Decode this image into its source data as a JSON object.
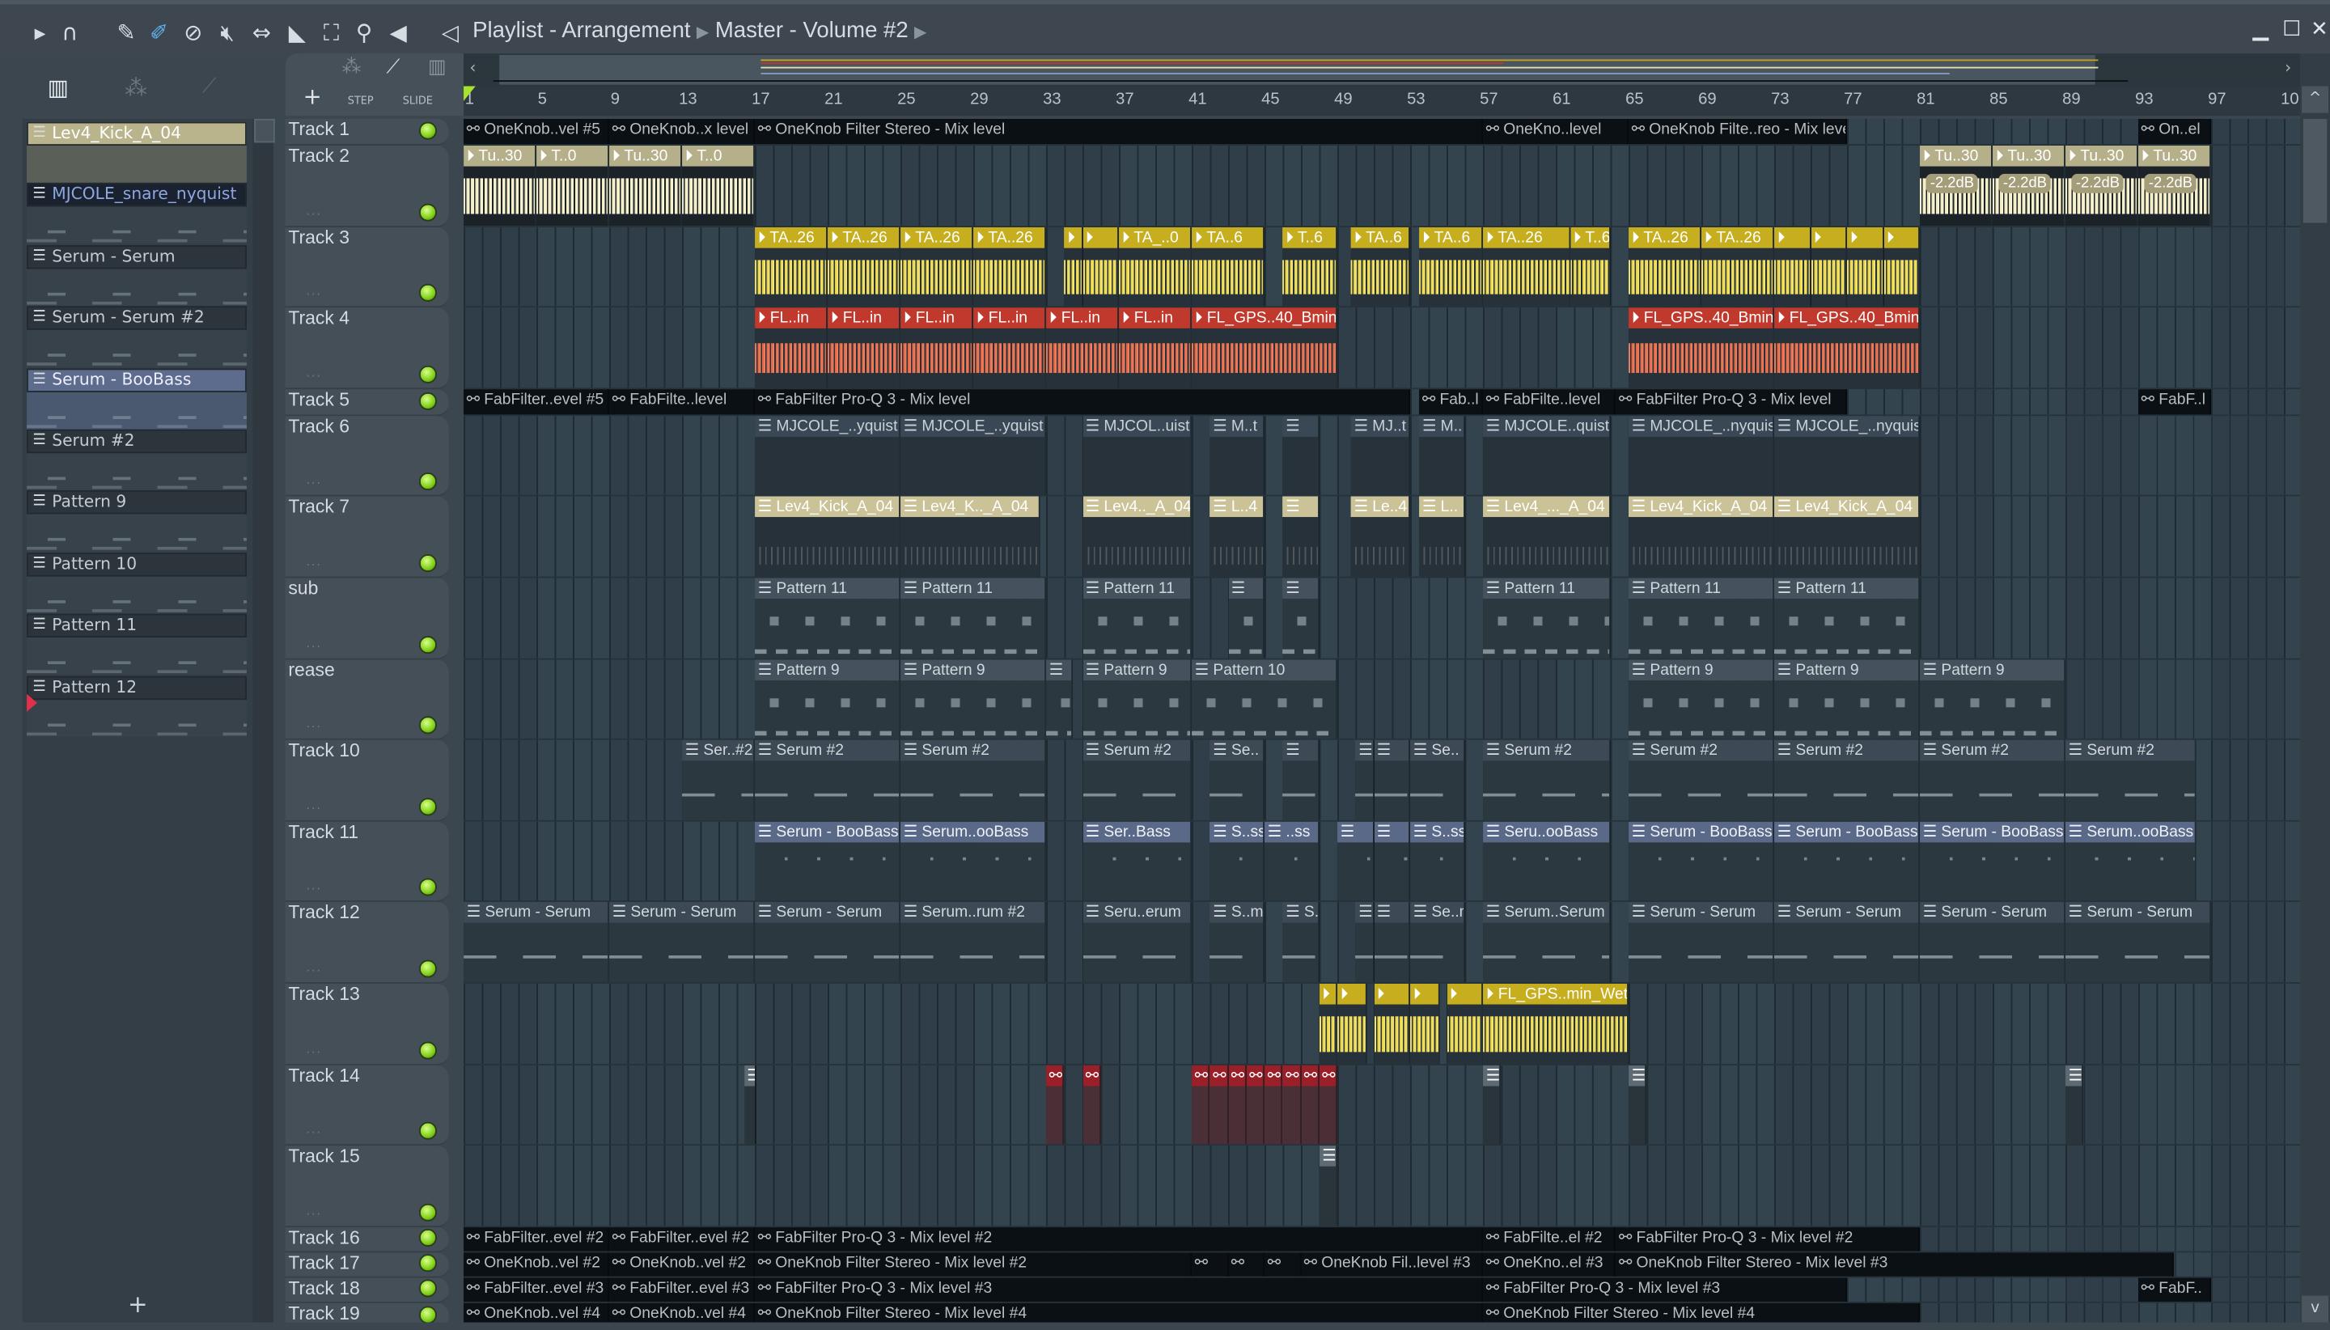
{
  "window": {
    "title": "Playlist - Arrangement",
    "breadcrumb": [
      "Playlist - Arrangement",
      "Master - Volume #2"
    ]
  },
  "toolbar": {
    "icons": [
      "play-arrow-icon",
      "magnet-icon",
      "pencil-icon",
      "paint-brush-icon",
      "delete-icon",
      "mute-icon",
      "slip-icon",
      "slice-icon",
      "select-icon",
      "zoom-icon",
      "playback-icon",
      "speaker-icon"
    ],
    "step_label": "STEP",
    "slide_label": "SLIDE",
    "add_label": "+"
  },
  "ruler": {
    "ticks": [
      "1",
      "5",
      "9",
      "13",
      "17",
      "21",
      "25",
      "29",
      "33",
      "37",
      "41",
      "45",
      "49",
      "53",
      "57",
      "61",
      "65",
      "69",
      "73",
      "77",
      "81",
      "85",
      "89",
      "93",
      "97",
      "10"
    ]
  },
  "patterns": [
    {
      "name": "Lev4_Kick_A_04",
      "style": "sel"
    },
    {
      "name": "MJCOLE_snare_nyquist",
      "style": "blue"
    },
    {
      "name": "Serum - Serum",
      "style": ""
    },
    {
      "name": "Serum - Serum #2",
      "style": ""
    },
    {
      "name": "Serum - BooBass",
      "style": "boo"
    },
    {
      "name": "Serum #2",
      "style": ""
    },
    {
      "name": "Pattern 9",
      "style": ""
    },
    {
      "name": "Pattern 10",
      "style": ""
    },
    {
      "name": "Pattern 11",
      "style": ""
    },
    {
      "name": "Pattern 12",
      "style": ""
    }
  ],
  "tracks": [
    {
      "name": "Track 1",
      "kind": "auto",
      "clips": [
        [
          1,
          9,
          "OneKnob..vel #5"
        ],
        [
          9,
          17,
          "OneKnob..x level"
        ],
        [
          17,
          57,
          "OneKnob Filter Stereo - Mix level"
        ],
        [
          57,
          65,
          "OneKno..level"
        ],
        [
          65,
          77,
          "OneKnob Filte..reo - Mix level"
        ],
        [
          93,
          97,
          "On..el"
        ]
      ]
    },
    {
      "name": "Track 2",
      "kind": "cream",
      "clips": [
        [
          1,
          5,
          "Tu..30"
        ],
        [
          5,
          9,
          "T..0"
        ],
        [
          9,
          13,
          "Tu..30"
        ],
        [
          13,
          17,
          "T..0"
        ],
        [
          81,
          85,
          "Tu..30",
          "-2.2dB"
        ],
        [
          85,
          89,
          "Tu..30",
          "-2.2dB"
        ],
        [
          89,
          93,
          "Tu..30",
          "-2.2dB"
        ],
        [
          93,
          97,
          "Tu..30",
          "-2.2dB"
        ]
      ]
    },
    {
      "name": "Track 3",
      "kind": "yellow",
      "clips": [
        [
          17,
          21,
          "TA..26"
        ],
        [
          21,
          25,
          "TA..26"
        ],
        [
          25,
          29,
          "TA..26"
        ],
        [
          29,
          33,
          "TA..26"
        ],
        [
          34,
          35,
          ""
        ],
        [
          35,
          37,
          ""
        ],
        [
          37,
          41,
          "TA_..0"
        ],
        [
          41,
          45,
          "TA..6"
        ],
        [
          46,
          49,
          "T..6"
        ],
        [
          49.75,
          53,
          "TA..6"
        ],
        [
          53.5,
          57,
          "TA..6"
        ],
        [
          57,
          61.8,
          "TA..26"
        ],
        [
          61.8,
          64,
          "T..6"
        ],
        [
          65,
          69,
          "TA..26"
        ],
        [
          69,
          73,
          "TA..26"
        ],
        [
          73,
          75,
          ""
        ],
        [
          75,
          77,
          ""
        ],
        [
          77,
          79,
          ""
        ],
        [
          79,
          81,
          ""
        ]
      ]
    },
    {
      "name": "Track 4",
      "kind": "red",
      "clips": [
        [
          17,
          21,
          "FL..in"
        ],
        [
          21,
          25,
          "FL..in"
        ],
        [
          25,
          29,
          "FL..in"
        ],
        [
          29,
          33,
          "FL..in"
        ],
        [
          33,
          37,
          "FL..in"
        ],
        [
          37,
          41,
          "FL..in"
        ],
        [
          41,
          49,
          "FL_GPS..40_Bmin"
        ],
        [
          65,
          73,
          "FL_GPS..40_Bmin"
        ],
        [
          73,
          81,
          "FL_GPS..40_Bmin"
        ]
      ]
    },
    {
      "name": "Track 5",
      "kind": "auto",
      "clips": [
        [
          1,
          9,
          "FabFilter..evel #5"
        ],
        [
          9,
          17,
          "FabFilte..level"
        ],
        [
          17,
          53,
          "FabFilter Pro-Q 3 - Mix level"
        ],
        [
          53.5,
          57,
          "Fab..l"
        ],
        [
          57,
          64.3,
          "FabFilte..level"
        ],
        [
          64.3,
          77,
          "FabFilter Pro-Q 3 - Mix level"
        ],
        [
          93,
          97,
          "FabF..l"
        ]
      ]
    },
    {
      "name": "Track 6",
      "kind": "mj",
      "clips": [
        [
          17,
          25,
          "MJCOLE_..yquist"
        ],
        [
          25,
          33,
          "MJCOLE_..yquist"
        ],
        [
          35,
          41,
          "MJCOL..uist"
        ],
        [
          42,
          45,
          "M..t"
        ],
        [
          46,
          48,
          ""
        ],
        [
          49.75,
          53,
          "MJ..t"
        ],
        [
          53.5,
          56,
          "M.."
        ],
        [
          57,
          64,
          "MJCOLE..quist"
        ],
        [
          65,
          73,
          "MJCOLE_..nyquist"
        ],
        [
          73,
          81,
          "MJCOLE_..nyquist"
        ]
      ]
    },
    {
      "name": "Track 7",
      "kind": "kick",
      "clips": [
        [
          17,
          25,
          "Lev4_Kick_A_04"
        ],
        [
          25,
          32.7,
          "Lev4_K.._A_04"
        ],
        [
          35,
          41,
          "Lev4.._A_04"
        ],
        [
          42,
          45,
          "L..4"
        ],
        [
          46,
          48,
          ""
        ],
        [
          49.75,
          53,
          "Le..4"
        ],
        [
          53.5,
          56,
          "L.."
        ],
        [
          57,
          64,
          "Lev4_..._A_04"
        ],
        [
          65,
          73,
          "Lev4_Kick_A_04"
        ],
        [
          73,
          81,
          "Lev4_Kick_A_04"
        ]
      ]
    },
    {
      "name": "sub",
      "kind": "pat",
      "clips": [
        [
          17,
          25,
          "Pattern 11"
        ],
        [
          25,
          33,
          "Pattern 11"
        ],
        [
          35,
          41,
          "Pattern 11"
        ],
        [
          43,
          45,
          ""
        ],
        [
          46,
          48,
          ""
        ],
        [
          57,
          64,
          "Pattern 11"
        ],
        [
          65,
          73,
          "Pattern 11"
        ],
        [
          73,
          81,
          "Pattern 11"
        ]
      ]
    },
    {
      "name": "rease",
      "kind": "pat",
      "clips": [
        [
          17,
          25,
          "Pattern 9"
        ],
        [
          25,
          33,
          "Pattern 9"
        ],
        [
          33,
          34.5,
          ""
        ],
        [
          35,
          41,
          "Pattern 9"
        ],
        [
          41,
          49,
          "Pattern 10"
        ],
        [
          65,
          73,
          "Pattern 9"
        ],
        [
          73,
          81,
          "Pattern 9"
        ],
        [
          81,
          89,
          "Pattern 9"
        ]
      ]
    },
    {
      "name": "Track 10",
      "kind": "ser",
      "clips": [
        [
          13,
          17,
          "Ser..#2"
        ],
        [
          17,
          25,
          "Serum #2"
        ],
        [
          25,
          33,
          "Serum #2"
        ],
        [
          35,
          41,
          "Serum #2"
        ],
        [
          42,
          45,
          "Se.."
        ],
        [
          46,
          48,
          ""
        ],
        [
          50,
          51,
          ""
        ],
        [
          51,
          53,
          ""
        ],
        [
          53,
          56,
          "Se.."
        ],
        [
          57,
          64,
          "Serum #2"
        ],
        [
          65,
          73,
          "Serum #2"
        ],
        [
          73,
          81,
          "Serum #2"
        ],
        [
          81,
          89,
          "Serum #2"
        ],
        [
          89,
          96.2,
          "Serum #2"
        ]
      ]
    },
    {
      "name": "Track 11",
      "kind": "boo",
      "clips": [
        [
          17,
          25,
          "Serum - BooBass"
        ],
        [
          25,
          33,
          "Serum..ooBass"
        ],
        [
          35,
          41,
          "Ser..Bass"
        ],
        [
          42,
          45,
          "S..ss"
        ],
        [
          45,
          48,
          "..ss"
        ],
        [
          49,
          51,
          ""
        ],
        [
          51,
          53,
          ""
        ],
        [
          53,
          56,
          "S..ss"
        ],
        [
          57,
          64,
          "Seru..ooBass"
        ],
        [
          65,
          73,
          "Serum - BooBass"
        ],
        [
          73,
          81,
          "Serum - BooBass"
        ],
        [
          81,
          89,
          "Serum - BooBass"
        ],
        [
          89,
          96.2,
          "Serum..ooBass"
        ]
      ]
    },
    {
      "name": "Track 12",
      "kind": "ser",
      "clips": [
        [
          1,
          9,
          "Serum - Serum"
        ],
        [
          9,
          17,
          "Serum - Serum"
        ],
        [
          17,
          25,
          "Serum - Serum"
        ],
        [
          25,
          33,
          "Serum..rum #2"
        ],
        [
          35,
          41,
          "Seru..erum"
        ],
        [
          42,
          45,
          "S..m"
        ],
        [
          46,
          48,
          "S.."
        ],
        [
          50,
          51,
          ""
        ],
        [
          51,
          53,
          ""
        ],
        [
          53,
          56,
          "Se..m"
        ],
        [
          57,
          64,
          "Serum..Serum"
        ],
        [
          65,
          73,
          "Serum - Serum"
        ],
        [
          73,
          81,
          "Serum - Serum"
        ],
        [
          81,
          89,
          "Serum - Serum"
        ],
        [
          89,
          97,
          "Serum - Serum"
        ]
      ]
    },
    {
      "name": "Track 13",
      "kind": "yellow",
      "clips": [
        [
          48,
          49,
          ""
        ],
        [
          49,
          50.6,
          ""
        ],
        [
          51,
          53,
          ""
        ],
        [
          53,
          54.6,
          ""
        ],
        [
          55,
          57,
          ""
        ],
        [
          57,
          65,
          "FL_GPS..min_Wet"
        ]
      ]
    },
    {
      "name": "Track 14",
      "kind": "small",
      "clips": [
        [
          16.4,
          17.1,
          ""
        ],
        [
          33,
          34,
          ""
        ],
        [
          35,
          36,
          ""
        ],
        [
          41,
          42,
          ""
        ],
        [
          42,
          43,
          ""
        ],
        [
          43,
          44,
          ""
        ],
        [
          44,
          45,
          ""
        ],
        [
          45,
          46,
          ""
        ],
        [
          46,
          47,
          ""
        ],
        [
          47,
          48,
          ""
        ],
        [
          48,
          49,
          ""
        ],
        [
          57,
          58,
          ""
        ],
        [
          65,
          66,
          ""
        ],
        [
          89,
          90,
          ""
        ]
      ]
    },
    {
      "name": "Track 15",
      "kind": "small",
      "clips": [
        [
          48,
          49,
          ""
        ]
      ]
    },
    {
      "name": "Track 16",
      "kind": "auto",
      "clips": [
        [
          1,
          9,
          "FabFilter..evel #2"
        ],
        [
          9,
          17,
          "FabFilter..evel #2"
        ],
        [
          17,
          57,
          "FabFilter Pro-Q 3 - Mix level #2"
        ],
        [
          57,
          64.3,
          "FabFilte..el #2"
        ],
        [
          64.3,
          81,
          "FabFilter Pro-Q 3 - Mix level #2"
        ]
      ]
    },
    {
      "name": "Track 17",
      "kind": "auto",
      "clips": [
        [
          1,
          9,
          "OneKnob..vel #2"
        ],
        [
          9,
          17,
          "OneKnob..vel #2"
        ],
        [
          17,
          41,
          "OneKnob Filter Stereo - Mix level #2"
        ],
        [
          41,
          43,
          ""
        ],
        [
          43,
          45,
          ""
        ],
        [
          45,
          47,
          ""
        ],
        [
          47,
          57,
          "OneKnob Fil..level #3"
        ],
        [
          57,
          64.3,
          "OneKno..el #3"
        ],
        [
          64.3,
          95,
          "OneKnob Filter Stereo - Mix level #3"
        ]
      ]
    },
    {
      "name": "Track 18",
      "kind": "auto",
      "clips": [
        [
          1,
          9,
          "FabFilter..evel #3"
        ],
        [
          9,
          17,
          "FabFilter..evel #3"
        ],
        [
          17,
          57,
          "FabFilter Pro-Q 3 - Mix level #3"
        ],
        [
          57,
          77,
          "FabFilter Pro-Q 3 - Mix level #3"
        ],
        [
          93,
          97,
          "FabF.."
        ]
      ]
    },
    {
      "name": "Track 19",
      "kind": "auto",
      "clips": [
        [
          1,
          9,
          "OneKnob..vel #4"
        ],
        [
          9,
          17,
          "OneKnob..vel #4"
        ],
        [
          17,
          57,
          "OneKnob Filter Stereo - Mix level #4"
        ],
        [
          57,
          81,
          "OneKnob Filter Stereo - Mix level #4"
        ]
      ]
    }
  ],
  "colors": {
    "accent_led": "#7fcf18",
    "audio_yellow": "#c6ae1e",
    "audio_red": "#c0392c",
    "audio_cream": "#b6b08a"
  }
}
